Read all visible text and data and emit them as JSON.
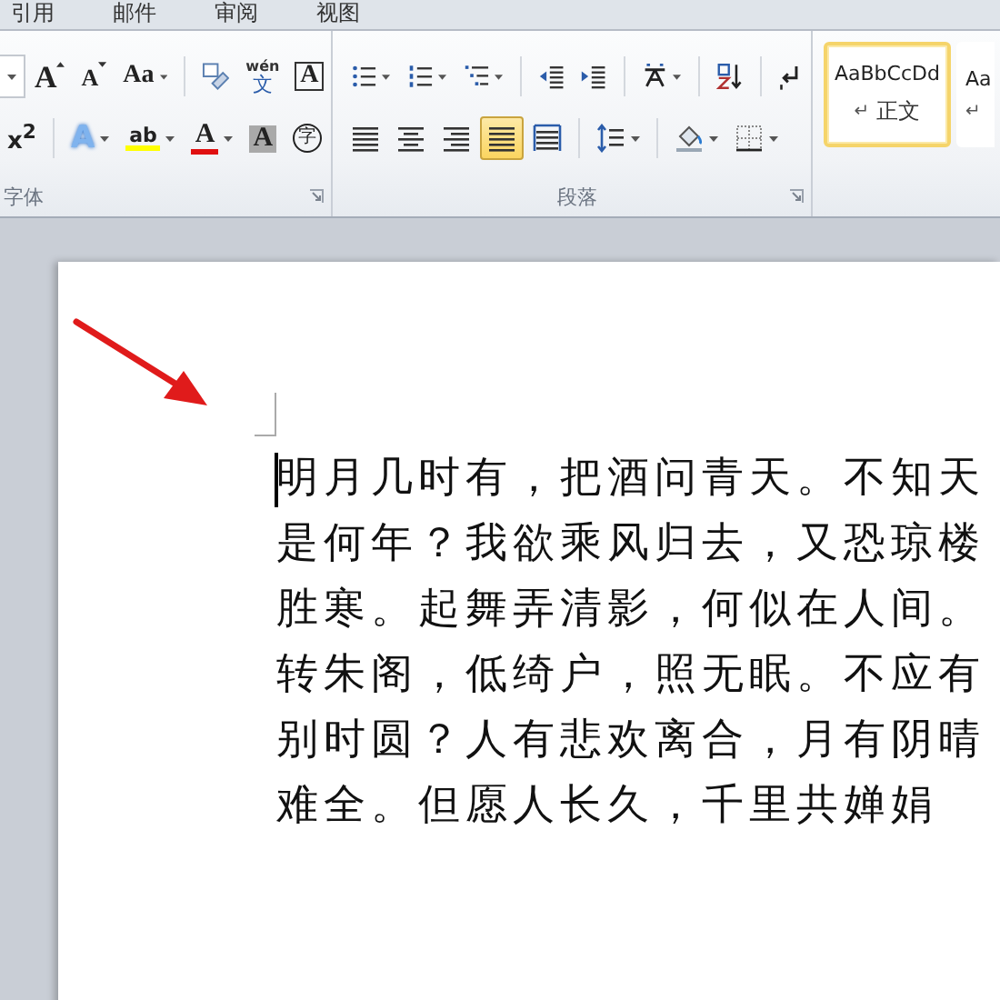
{
  "tabs": [
    {
      "label": "引用"
    },
    {
      "label": "邮件"
    },
    {
      "label": "审阅"
    },
    {
      "label": "视图"
    }
  ],
  "font_group": {
    "label": "字体",
    "row1": [
      {
        "kind": "combo-edge",
        "dropdown": true
      },
      {
        "kind": "grow",
        "glyph": "A"
      },
      {
        "kind": "shrink",
        "glyph": "A"
      },
      {
        "kind": "case",
        "glyph": "Aa",
        "dropdown": true
      },
      {
        "kind": "sep"
      },
      {
        "kind": "clear"
      },
      {
        "kind": "phonetic",
        "glyph": "wén",
        "glyph2": "文"
      },
      {
        "kind": "border",
        "glyph": "A"
      }
    ],
    "row2": [
      {
        "kind": "superscript",
        "glyph": "x$^{2}$"
      },
      {
        "kind": "sep"
      },
      {
        "kind": "effects",
        "glyph": "A",
        "dropdown": true
      },
      {
        "kind": "highlight",
        "glyph": "ab",
        "dropdown": true
      },
      {
        "kind": "color",
        "glyph": "A",
        "dropdown": true
      },
      {
        "kind": "shading",
        "glyph": "A"
      },
      {
        "kind": "enclose",
        "glyph": "字"
      }
    ]
  },
  "paragraph_group": {
    "label": "段落",
    "row1": [
      {
        "kind": "bullets",
        "dropdown": true
      },
      {
        "kind": "numbering",
        "dropdown": true
      },
      {
        "kind": "multilevel",
        "dropdown": true
      },
      {
        "kind": "sep"
      },
      {
        "kind": "outdent"
      },
      {
        "kind": "indent"
      },
      {
        "kind": "sep"
      },
      {
        "kind": "asian",
        "dropdown": true
      },
      {
        "kind": "sep"
      },
      {
        "kind": "sort"
      },
      {
        "kind": "sep"
      },
      {
        "kind": "marks"
      }
    ],
    "alignment": [
      {
        "kind": "left",
        "selected": false
      },
      {
        "kind": "center",
        "selected": false
      },
      {
        "kind": "right",
        "selected": false
      },
      {
        "kind": "justify",
        "selected": true
      },
      {
        "kind": "distribute",
        "selected": false
      }
    ],
    "row2": [
      {
        "kind": "sep"
      },
      {
        "kind": "spacing",
        "dropdown": true
      },
      {
        "kind": "sep"
      },
      {
        "kind": "fill",
        "dropdown": true
      },
      {
        "kind": "borders",
        "dropdown": true
      }
    ]
  },
  "styles": [
    {
      "preview": "AaBbCcDd",
      "mark": "↵",
      "name": "正文",
      "selected": true
    },
    {
      "preview": "Aa",
      "mark": "↵",
      "selected": false
    }
  ],
  "document": {
    "cursor": true,
    "lines": [
      "明月几时有，把酒问青天。不知天",
      "是何年？我欲乘风归去，又恐琼楼",
      "胜寒。起舞弄清影，何似在人间。",
      "转朱阁，低绮户，照无眠。不应有",
      "别时圆？人有悲欢离合，月有阴晴",
      "难全。但愿人长久，千里共婵娟"
    ]
  }
}
